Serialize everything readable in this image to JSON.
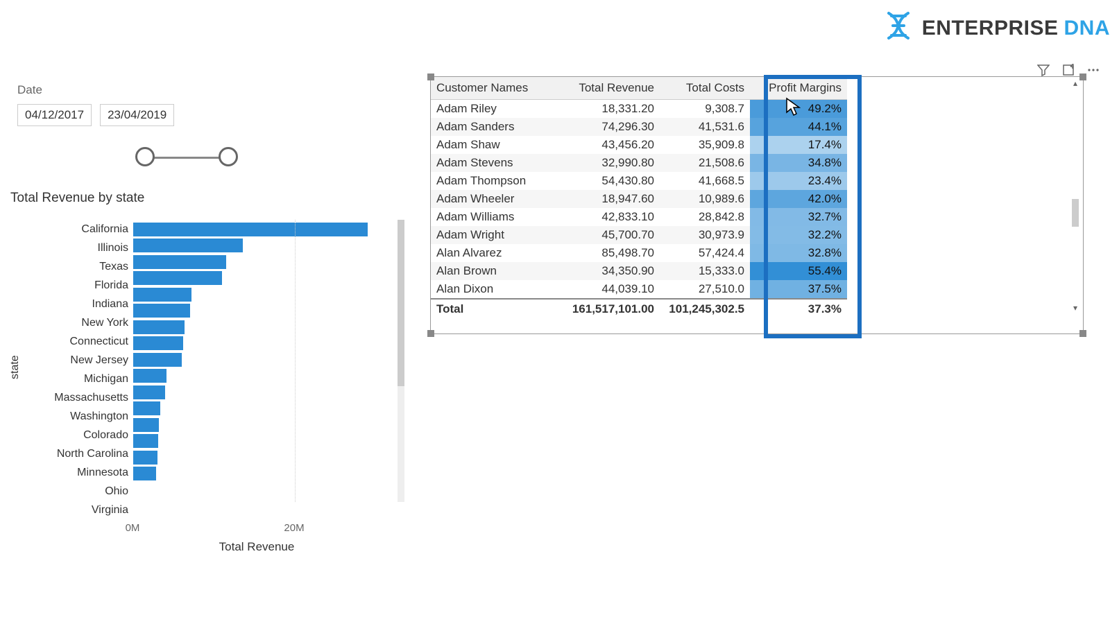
{
  "logo": {
    "text1": "ENTERPRISE",
    "text2": "DNA"
  },
  "date_slicer": {
    "label": "Date",
    "from": "04/12/2017",
    "to": "23/04/2019"
  },
  "chart_data": {
    "type": "bar",
    "title": "Total Revenue by state",
    "xlabel": "Total Revenue",
    "ylabel": "state",
    "x_ticks": [
      "0M",
      "20M"
    ],
    "xlim": [
      0,
      30000000
    ],
    "categories": [
      "California",
      "Illinois",
      "Texas",
      "Florida",
      "Indiana",
      "New York",
      "Connecticut",
      "New Jersey",
      "Michigan",
      "Massachusetts",
      "Washington",
      "Colorado",
      "North Carolina",
      "Minnesota",
      "Ohio",
      "Virginia"
    ],
    "values": [
      29000000,
      13500000,
      11500000,
      11000000,
      7200000,
      7000000,
      6300000,
      6200000,
      6000000,
      4100000,
      3900000,
      3300000,
      3200000,
      3100000,
      3000000,
      2800000
    ]
  },
  "table": {
    "columns": [
      "Customer Names",
      "Total Revenue",
      "Total Costs",
      "Profit Margins"
    ],
    "rows": [
      {
        "name": "Adam Riley",
        "rev": "18,331.20",
        "cost": "9,308.7",
        "pm": "49.2%",
        "shade": 0.8
      },
      {
        "name": "Adam Sanders",
        "rev": "74,296.30",
        "cost": "41,531.6",
        "pm": "44.1%",
        "shade": 0.72
      },
      {
        "name": "Adam Shaw",
        "rev": "43,456.20",
        "cost": "35,909.8",
        "pm": "17.4%",
        "shade": 0.18
      },
      {
        "name": "Adam Stevens",
        "rev": "32,990.80",
        "cost": "21,508.6",
        "pm": "34.8%",
        "shade": 0.5
      },
      {
        "name": "Adam Thompson",
        "rev": "54,430.80",
        "cost": "41,668.5",
        "pm": "23.4%",
        "shade": 0.28
      },
      {
        "name": "Adam Wheeler",
        "rev": "18,947.60",
        "cost": "10,989.6",
        "pm": "42.0%",
        "shade": 0.68
      },
      {
        "name": "Adam Williams",
        "rev": "42,833.10",
        "cost": "28,842.8",
        "pm": "32.7%",
        "shade": 0.46
      },
      {
        "name": "Adam Wright",
        "rev": "45,700.70",
        "cost": "30,973.9",
        "pm": "32.2%",
        "shade": 0.44
      },
      {
        "name": "Alan Alvarez",
        "rev": "85,498.70",
        "cost": "57,424.4",
        "pm": "32.8%",
        "shade": 0.47
      },
      {
        "name": "Alan Brown",
        "rev": "34,350.90",
        "cost": "15,333.0",
        "pm": "55.4%",
        "shade": 0.95
      },
      {
        "name": "Alan Dixon",
        "rev": "44,039.10",
        "cost": "27,510.0",
        "pm": "37.5%",
        "shade": 0.56
      }
    ],
    "totals": {
      "name": "Total",
      "rev": "161,517,101.00",
      "cost": "101,245,302.5",
      "pm": "37.3%"
    }
  }
}
